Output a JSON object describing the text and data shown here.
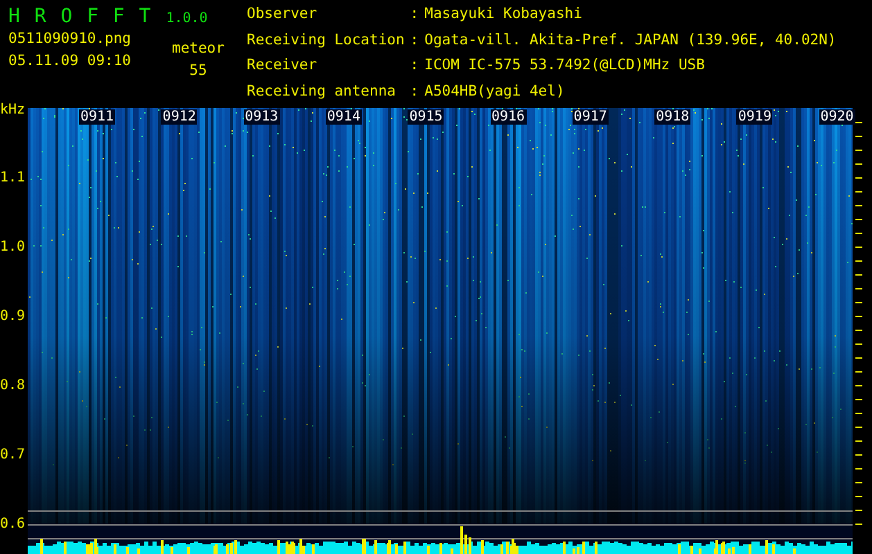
{
  "app": {
    "name": "H R O F F T",
    "version": "1.0.0"
  },
  "file": {
    "name": "0511090910.png",
    "datetime": "05.11.09 09:10"
  },
  "meteor": {
    "label": "meteor",
    "count": "55"
  },
  "info": [
    {
      "label": "Observer",
      "separator": ":",
      "value": "Masayuki Kobayashi"
    },
    {
      "label": "Receiving Location",
      "separator": ":",
      "value": "Ogata-vill. Akita-Pref. JAPAN (139.96E, 40.02N)"
    },
    {
      "label": "Receiver",
      "separator": ":",
      "value": "ICOM IC-575 53.7492(@LCD)MHz USB"
    },
    {
      "label": "Receiving antenna",
      "separator": ":",
      "value": "A504HB(yagi 4el)"
    }
  ],
  "spectrogram": {
    "unit": "kHz",
    "time_labels": [
      "0911",
      "0912",
      "0913",
      "0914",
      "0915",
      "0916",
      "0917",
      "0918",
      "0919",
      "0920"
    ],
    "freq_labels": [
      "1.1",
      "1.0",
      "0.9",
      "0.8",
      "0.7",
      "0.6"
    ]
  }
}
